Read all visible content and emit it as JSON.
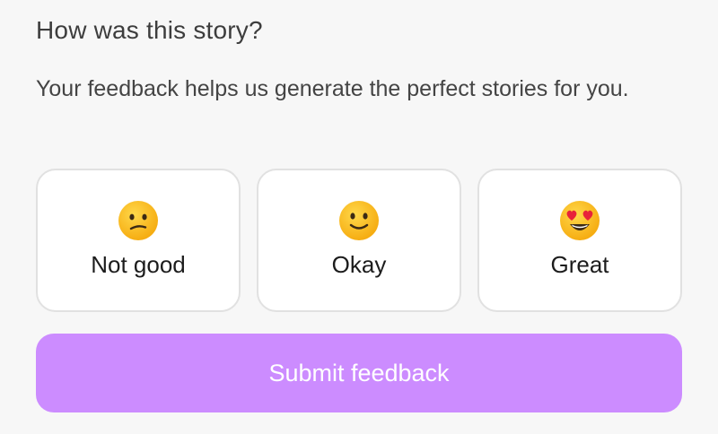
{
  "feedback": {
    "title": "How was this story?",
    "description": "Your feedback helps us generate the perfect stories for you.",
    "options": [
      {
        "label": "Not good",
        "icon": "confused-face-icon"
      },
      {
        "label": "Okay",
        "icon": "slightly-smiling-face-icon"
      },
      {
        "label": "Great",
        "icon": "heart-eyes-face-icon"
      }
    ],
    "submit_label": "Submit feedback"
  },
  "colors": {
    "background": "#f7f7f7",
    "card_border": "#e1e1e1",
    "submit_background": "#cc8cff",
    "submit_text": "#ffffff",
    "emoji_yellow": "#fcc21b"
  }
}
